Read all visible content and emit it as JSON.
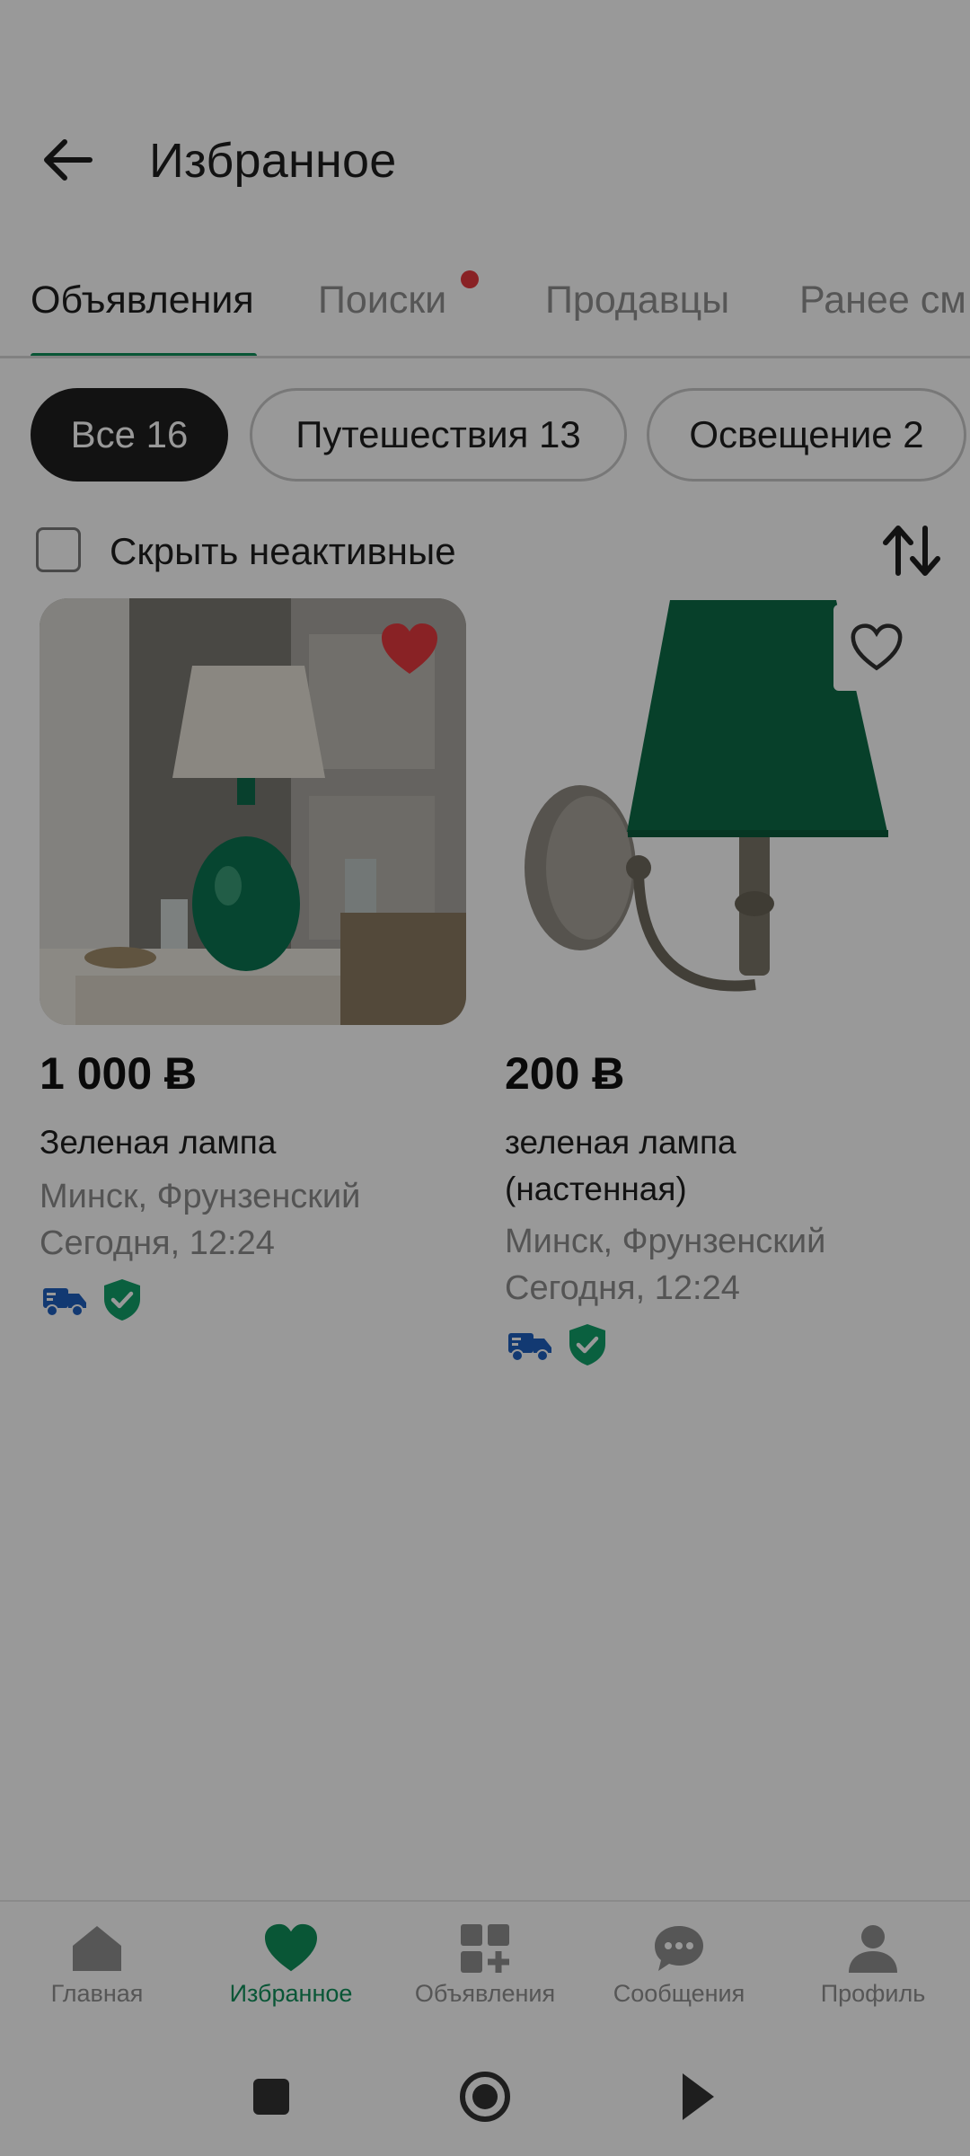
{
  "header": {
    "title": "Избранное"
  },
  "tabs": [
    {
      "label": "Объявления",
      "active": true
    },
    {
      "label": "Поиски",
      "has_dot": true
    },
    {
      "label": "Продавцы"
    },
    {
      "label": "Ранее см"
    }
  ],
  "chips": [
    {
      "label": "Все 16",
      "selected": true
    },
    {
      "label": "Путешествия 13"
    },
    {
      "label": "Освещение 2"
    }
  ],
  "filter": {
    "hide_inactive_label": "Скрыть неактивные",
    "checked": false
  },
  "listings": [
    {
      "price": "1 000 Ƀ",
      "title": "Зеленая лампа",
      "location": "Минск, Фрунзенский",
      "time": "Сегодня, 12:24",
      "favorited": true,
      "badges": [
        "delivery-truck-icon",
        "verified-shield-icon"
      ]
    },
    {
      "price": "200 Ƀ",
      "title_line1": "зеленая лампа",
      "title_line2": "(настенная)",
      "location": "Минск, Фрунзенский",
      "time": "Сегодня, 12:24",
      "favorited": false,
      "badges": [
        "delivery-truck-icon",
        "verified-shield-icon"
      ]
    }
  ],
  "bottom_nav": [
    {
      "label": "Главная",
      "icon": "home-icon"
    },
    {
      "label": "Избранное",
      "icon": "heart-icon",
      "active": true
    },
    {
      "label": "Объявления",
      "icon": "ads-grid-icon"
    },
    {
      "label": "Сообщения",
      "icon": "chat-icon"
    },
    {
      "label": "Профиль",
      "icon": "profile-icon"
    }
  ],
  "colors": {
    "accent": "#0f8f5a",
    "favorite": "#e5393e",
    "delivery": "#1f5fbf",
    "verified": "#12a06a"
  }
}
